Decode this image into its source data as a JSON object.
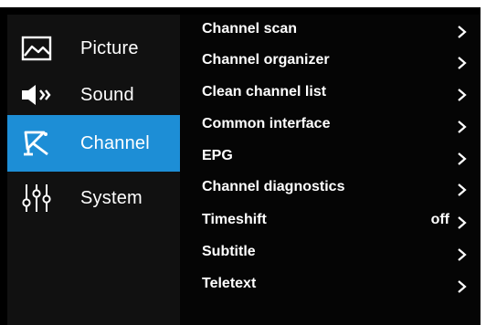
{
  "categories": [
    {
      "label": "Picture",
      "icon": "picture-icon",
      "selected": false
    },
    {
      "label": "Sound",
      "icon": "speaker-icon",
      "selected": false
    },
    {
      "label": "Channel",
      "icon": "satellite-dish-icon",
      "selected": true
    },
    {
      "label": "System",
      "icon": "sliders-icon",
      "selected": false
    }
  ],
  "menu": {
    "items": [
      {
        "label": "Channel scan",
        "value": ""
      },
      {
        "label": "Channel organizer",
        "value": ""
      },
      {
        "label": "Clean channel list",
        "value": ""
      },
      {
        "label": "Common interface",
        "value": ""
      },
      {
        "label": "EPG",
        "value": ""
      },
      {
        "label": "Channel diagnostics",
        "value": ""
      },
      {
        "label": "Timeshift",
        "value": "off"
      },
      {
        "label": "Subtitle",
        "value": ""
      },
      {
        "label": "Teletext",
        "value": ""
      }
    ]
  },
  "colors": {
    "accent": "#1d8ed6",
    "background": "#000000",
    "text": "#ffffff"
  }
}
